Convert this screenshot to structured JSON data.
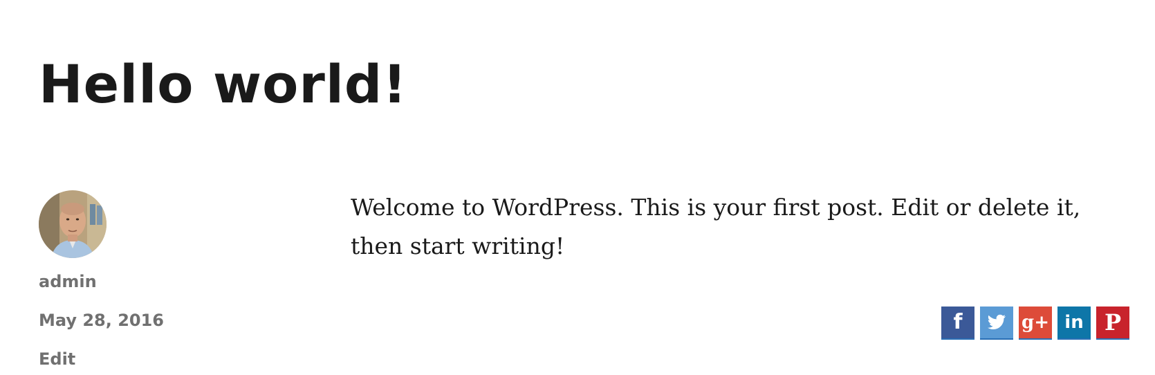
{
  "post": {
    "title": "Hello world!",
    "content": "Welcome to WordPress. This is your first post. Edit or delete it, then start writing!"
  },
  "meta": {
    "author": "admin",
    "date": "May 28, 2016",
    "edit_label": "Edit"
  },
  "share": [
    {
      "name": "facebook",
      "glyph": "f",
      "color": "#3b5998"
    },
    {
      "name": "twitter",
      "glyph": "t",
      "color": "#5b9bd5"
    },
    {
      "name": "google-plus",
      "glyph": "g+",
      "color": "#dd4b39"
    },
    {
      "name": "linkedin",
      "glyph": "in",
      "color": "#0e76a8"
    },
    {
      "name": "pinterest",
      "glyph": "P",
      "color": "#c8232c"
    }
  ]
}
